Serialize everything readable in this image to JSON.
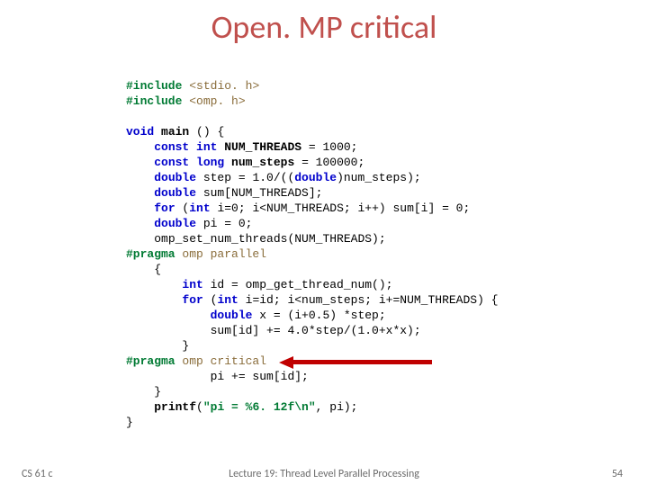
{
  "title": "Open. MP critical",
  "code": {
    "l1a": "#include",
    "l1b": "<stdio. h>",
    "l2a": "#include",
    "l2b": "<omp. h>",
    "l3_void": "void",
    "l3_main": "main",
    "l3_paren": " () {",
    "l4_const": "const int",
    "l4_name": "NUM_THREADS",
    "l4_rest": " = 1000;",
    "l5_const": "const long",
    "l5_name": "num_steps",
    "l5_rest": " = 100000;",
    "l6_dbl": "double",
    "l6_rest": " step = 1.0/((",
    "l6_dbl2": "double",
    "l6_rest2": ")num_steps);",
    "l7_dbl": "double",
    "l7_rest": " sum[NUM_THREADS];",
    "l8_for": "for",
    "l8_int": "int",
    "l8_rest": " i=0; i<NUM_THREADS; i++) sum[i] = 0;",
    "l9_dbl": "double",
    "l9_rest": " pi = 0;",
    "l10": "omp_set_num_threads(NUM_THREADS);",
    "l11a": "#pragma",
    "l11b": "omp parallel",
    "l12": "{",
    "l13_int": "int",
    "l13_rest": " id = omp_get_thread_num();",
    "l14_for": "for",
    "l14_int": "int",
    "l14_rest": " i=id; i<num_steps; i+=NUM_THREADS) {",
    "l15_dbl": "double",
    "l15_rest": " x = (i+0.5) *step;",
    "l16": "sum[id] += 4.0*step/(1.0+x*x);",
    "l17": "}",
    "l18a": "#pragma",
    "l18b": "omp critical",
    "l19": "pi += sum[id];",
    "l20": "}",
    "l21a": "printf",
    "l21b": "(",
    "l21c": "\"pi = %6. 12f\\n\"",
    "l21d": ", pi);",
    "l22": "}"
  },
  "footer": {
    "left": "CS 61 c",
    "center": "Lecture 19: Thread Level Parallel Processing",
    "right": "54"
  }
}
